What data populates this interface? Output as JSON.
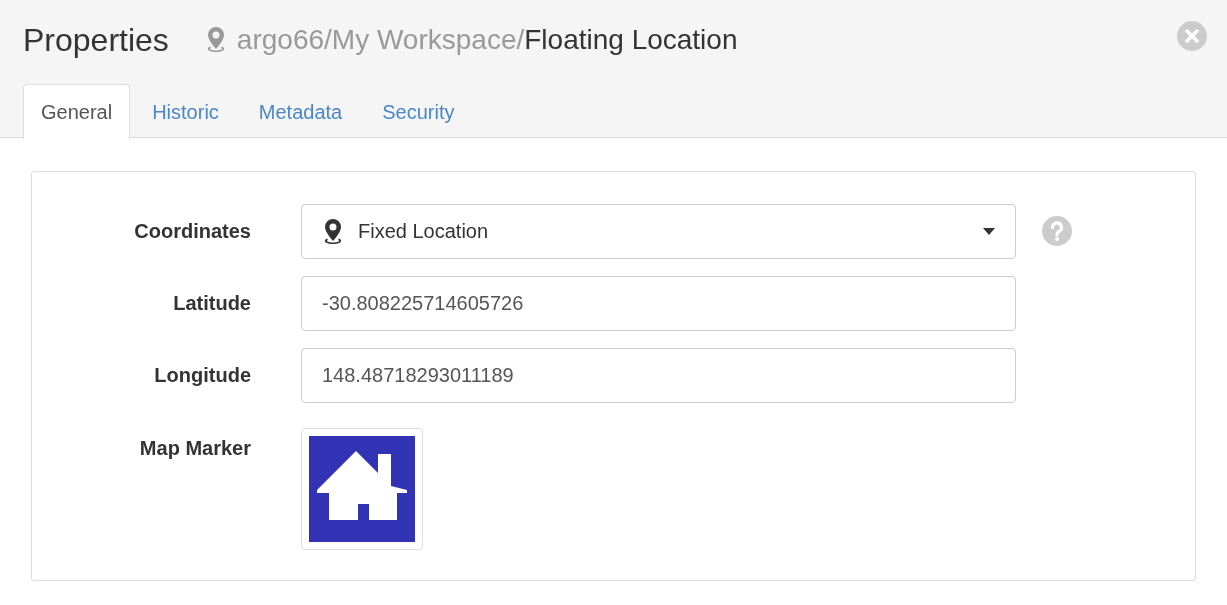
{
  "header": {
    "title": "Properties",
    "path_prefix": "argo66/My Workspace/",
    "path_name": "Floating Location"
  },
  "tabs": [
    {
      "label": "General",
      "selected": true
    },
    {
      "label": "Historic",
      "selected": false
    },
    {
      "label": "Metadata",
      "selected": false
    },
    {
      "label": "Security",
      "selected": false
    }
  ],
  "form": {
    "rows": [
      {
        "kind": "select",
        "label": "Coordinates",
        "value": "Fixed Location"
      },
      {
        "kind": "input",
        "label": "Latitude",
        "value": "-30.808225714605726"
      },
      {
        "kind": "input",
        "label": "Longitude",
        "value": "148.48718293011189"
      },
      {
        "kind": "marker",
        "label": "Map Marker"
      }
    ]
  }
}
